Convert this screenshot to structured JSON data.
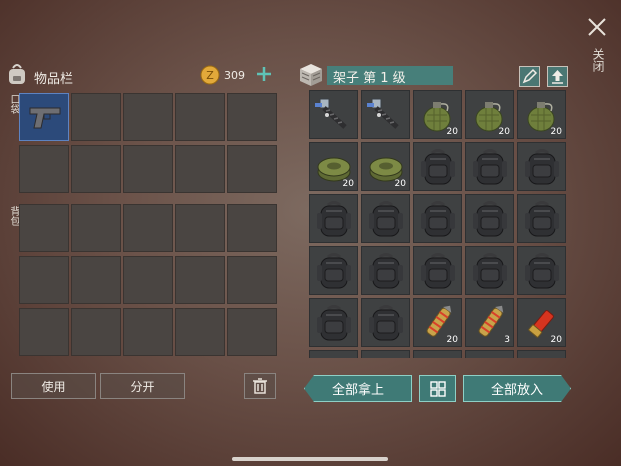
{
  "inventory": {
    "title": "物品栏",
    "coins": "309",
    "pocket_label": "口袋",
    "backpack_label": "背包",
    "use_label": "使用",
    "split_label": "分开"
  },
  "shelf": {
    "title": "架子 第 1 级",
    "take_all_label": "全部拿上",
    "put_all_label": "全部放入",
    "items": [
      {
        "icon": "drill-icon",
        "count": ""
      },
      {
        "icon": "drill-icon",
        "count": ""
      },
      {
        "icon": "grenade-icon",
        "count": "20"
      },
      {
        "icon": "grenade-icon",
        "count": "20"
      },
      {
        "icon": "grenade-icon",
        "count": "20"
      },
      {
        "icon": "landmine-icon",
        "count": "20"
      },
      {
        "icon": "landmine-icon",
        "count": "20"
      },
      {
        "icon": "backpack-icon",
        "count": ""
      },
      {
        "icon": "backpack-icon",
        "count": ""
      },
      {
        "icon": "backpack-icon",
        "count": ""
      },
      {
        "icon": "backpack-icon",
        "count": ""
      },
      {
        "icon": "backpack-icon",
        "count": ""
      },
      {
        "icon": "backpack-icon",
        "count": ""
      },
      {
        "icon": "backpack-icon",
        "count": ""
      },
      {
        "icon": "backpack-icon",
        "count": ""
      },
      {
        "icon": "backpack-icon",
        "count": ""
      },
      {
        "icon": "backpack-icon",
        "count": ""
      },
      {
        "icon": "backpack-icon",
        "count": ""
      },
      {
        "icon": "backpack-icon",
        "count": ""
      },
      {
        "icon": "backpack-icon",
        "count": ""
      },
      {
        "icon": "backpack-icon",
        "count": ""
      },
      {
        "icon": "backpack-icon",
        "count": ""
      },
      {
        "icon": "ammo-icon",
        "count": "20"
      },
      {
        "icon": "ammo-icon",
        "count": "3"
      },
      {
        "icon": "shell-icon",
        "count": "20"
      }
    ]
  },
  "close_label": "关闭",
  "colors": {
    "accent": "#3f7a76",
    "selected_slot": "#2c4a7a",
    "coin": "#e2a93a"
  }
}
